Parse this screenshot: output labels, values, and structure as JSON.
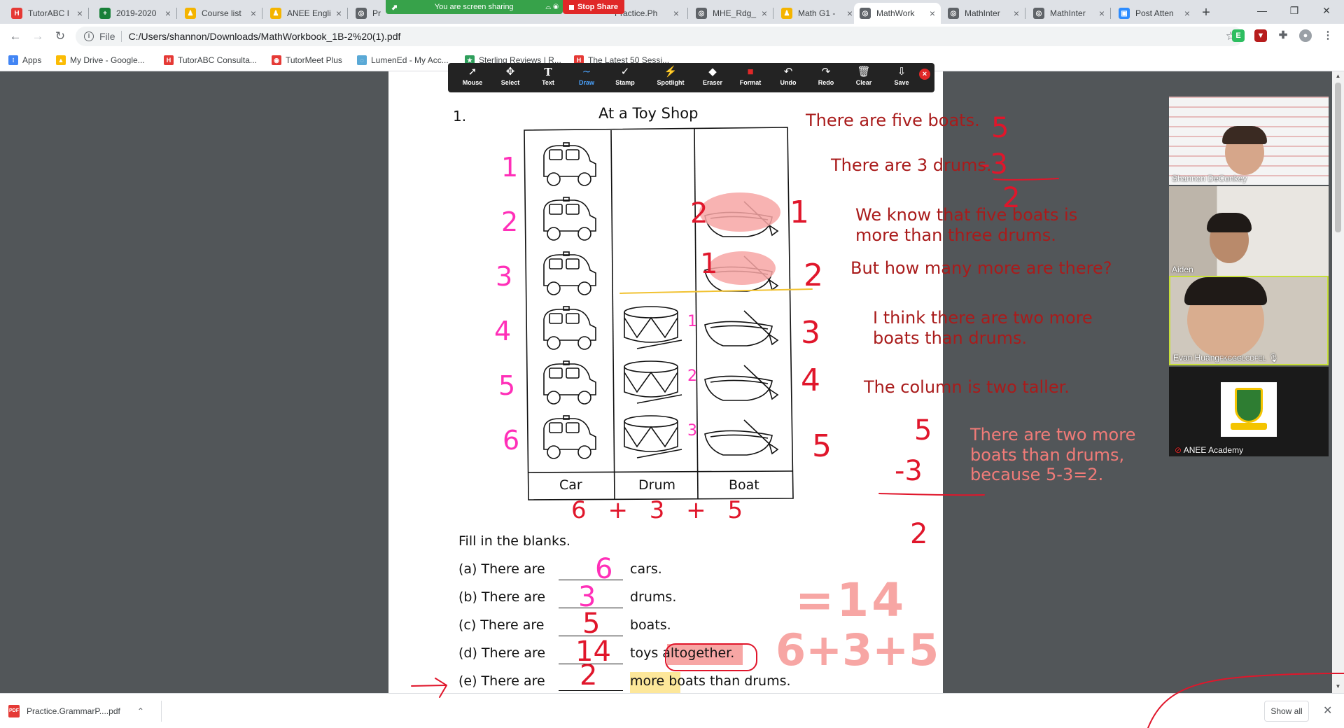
{
  "browser": {
    "tabs": [
      {
        "label": "TutorABC I",
        "color": "#e53935",
        "glyph": "H"
      },
      {
        "label": "2019-2020",
        "color": "#188038",
        "glyph": "+"
      },
      {
        "label": "Course list",
        "color": "#f4b400",
        "glyph": "♟"
      },
      {
        "label": "ANEE Engli",
        "color": "#f4b400",
        "glyph": "♟"
      },
      {
        "label": "Prac",
        "color": "#5f6368",
        "glyph": "◎"
      },
      {
        "label": "Practice.Ph",
        "color": "#5f6368",
        "glyph": "◎"
      },
      {
        "label": "MHE_Rdg_",
        "color": "#5f6368",
        "glyph": "◎"
      },
      {
        "label": "Math G1 -",
        "color": "#f4b400",
        "glyph": "♟"
      },
      {
        "label": "MathWork",
        "color": "#5f6368",
        "glyph": "◎"
      },
      {
        "label": "MathInter",
        "color": "#5f6368",
        "glyph": "◎"
      },
      {
        "label": "MathInter",
        "color": "#5f6368",
        "glyph": "◎"
      },
      {
        "label": "Post Atten",
        "color": "#2d8cff",
        "glyph": "▣"
      }
    ],
    "active_tab": 8,
    "new_tab": "+",
    "url_scheme": "File",
    "url": "C:/Users/shannon/Downloads/MathWorkbook_1B-2%20(1).pdf",
    "bookmarks": [
      {
        "label": "Apps",
        "color": "#4285f4",
        "glyph": "⁝"
      },
      {
        "label": "My Drive - Google...",
        "color": "#fbbc04",
        "glyph": "▲"
      },
      {
        "label": "TutorABC Consulta...",
        "color": "#e53935",
        "glyph": "H"
      },
      {
        "label": "TutorMeet Plus",
        "color": "#e53935",
        "glyph": "◉"
      },
      {
        "label": "LumenEd - My Acc...",
        "color": "#5aa9d6",
        "glyph": "◌"
      },
      {
        "label": "Sterling Reviews | R...",
        "color": "#2e9e5b",
        "glyph": "★"
      },
      {
        "label": "The Latest 50 Sessi...",
        "color": "#e53935",
        "glyph": "H"
      }
    ]
  },
  "share": {
    "status": "You are screen sharing",
    "stop_label": "Stop Share"
  },
  "annotation_toolbar": {
    "tools": [
      {
        "label": "Mouse",
        "icon": "mouse-pointer-icon",
        "glyph": "➚"
      },
      {
        "label": "Select",
        "icon": "move-arrows-icon",
        "glyph": "✥"
      },
      {
        "label": "Text",
        "icon": "text-icon",
        "glyph": "T"
      },
      {
        "label": "Draw",
        "icon": "pen-squiggle-icon",
        "glyph": "∼"
      },
      {
        "label": "Stamp",
        "icon": "checkmark-icon",
        "glyph": "✓"
      },
      {
        "label": "Spotlight",
        "icon": "wand-icon",
        "glyph": "⚡"
      },
      {
        "label": "Eraser",
        "icon": "eraser-icon",
        "glyph": "◆"
      },
      {
        "label": "Format",
        "icon": "format-color-icon",
        "glyph": "■"
      },
      {
        "label": "Undo",
        "icon": "undo-icon",
        "glyph": "↶"
      },
      {
        "label": "Redo",
        "icon": "redo-icon",
        "glyph": "↷"
      },
      {
        "label": "Clear",
        "icon": "trash-icon",
        "glyph": "🗑"
      },
      {
        "label": "Save",
        "icon": "save-icon",
        "glyph": "⇩"
      }
    ],
    "active_tool": "Draw",
    "close": "×"
  },
  "worksheet": {
    "exercise_number": "1.",
    "title": "At a Toy Shop",
    "columns": [
      "Car",
      "Drum",
      "Boat"
    ],
    "counts": {
      "Car": 6,
      "Drum": 3,
      "Boat": 5
    },
    "instruction": "Fill in the blanks.",
    "questions": [
      {
        "label": "(a) There are",
        "suffix": "cars."
      },
      {
        "label": "(b) There are",
        "suffix": "drums."
      },
      {
        "label": "(c) There are",
        "suffix": "boats."
      },
      {
        "label": "(d) There are",
        "suffix": "toys altogether."
      },
      {
        "label": "(e) There are",
        "suffix": "more boats than drums."
      }
    ]
  },
  "handwriting": {
    "answers": [
      "6",
      "3",
      "5",
      "14",
      "2"
    ],
    "row_numbers_cars": [
      "1",
      "2",
      "3",
      "4",
      "5",
      "6"
    ],
    "row_numbers_boats": [
      "1",
      "2",
      "3",
      "4",
      "5"
    ],
    "drum_numbers": [
      "1",
      "2",
      "3"
    ],
    "boat_red_numbers": [
      "2",
      "1"
    ],
    "under_table": "6 + 3 + 5",
    "sum_expression": "6+3+5",
    "sum_result": "=14",
    "subtraction_top": [
      "5",
      "-3",
      "2"
    ],
    "subtraction_bottom": [
      "5",
      "-3",
      "2"
    ]
  },
  "notes": [
    "There are five boats.",
    "There are 3 drums.",
    "We know that five boats is",
    "more than three drums.",
    "But how many more are there?",
    "I think there are two more",
    "boats than drums.",
    "The column is two taller.",
    "There are two more",
    "boats than drums,",
    "because 5-3=2."
  ],
  "participants": [
    {
      "name": "Shannon DeConkey"
    },
    {
      "name": "Aiden"
    },
    {
      "name": "Evan Huang",
      "suffix": "FKCGGLCDFEL"
    },
    {
      "name": "ANEE Academy"
    }
  ],
  "downloads": {
    "file": "Practice.GrammarP....pdf",
    "show_all": "Show all"
  },
  "colors": {
    "ink_red": "#e0162b",
    "ink_pink": "#ff2fb8",
    "note_dark_red": "#a91b1b",
    "note_light_red": "#f17b78",
    "highlight_pink": "#f7a6a4",
    "highlight_yellow": "#fde79a",
    "underline_yellow": "#f1c232",
    "zoom_green": "#37a24a",
    "stop_red": "#e02828"
  }
}
